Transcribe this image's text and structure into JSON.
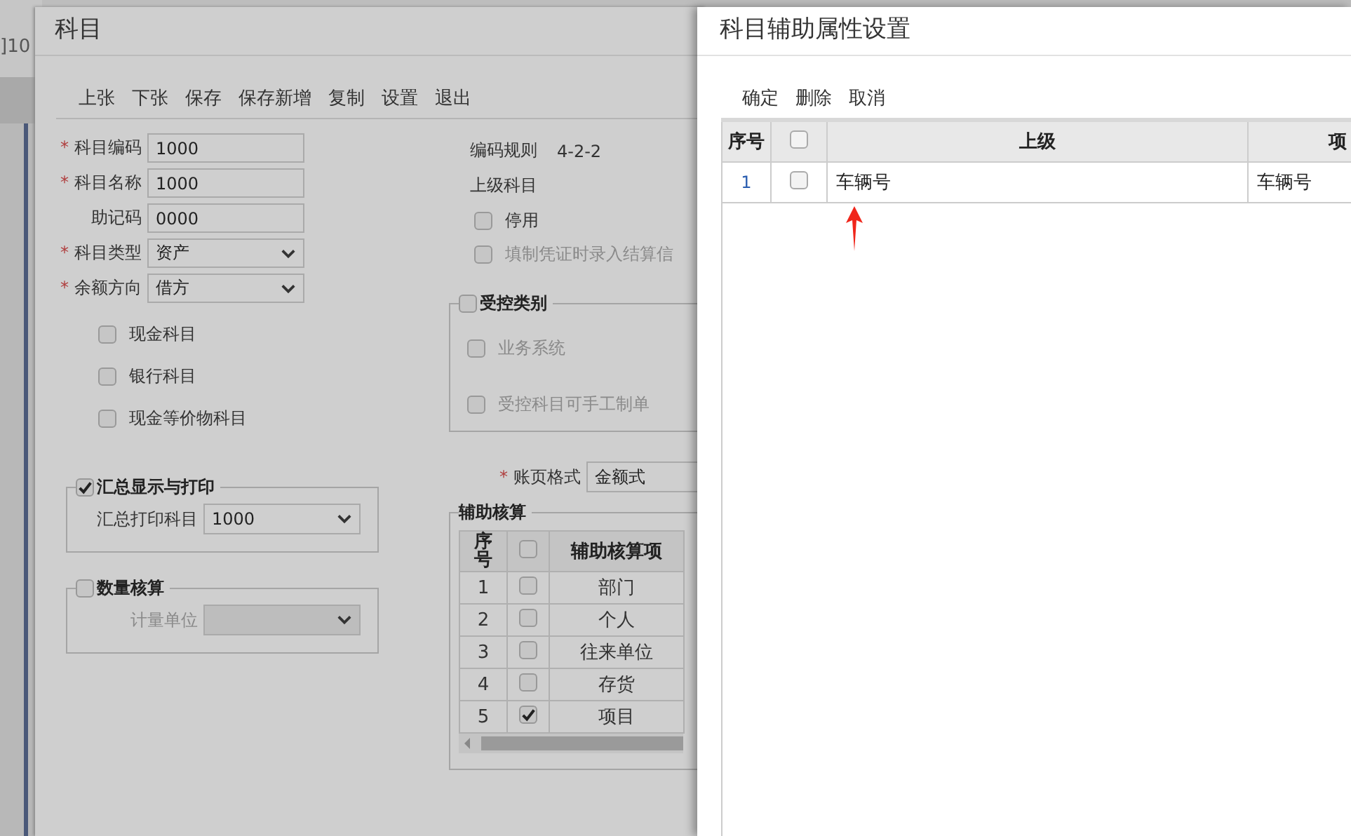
{
  "background_page": {
    "text": "]10"
  },
  "main_dialog": {
    "title": "科目",
    "toolbar": [
      "上张",
      "下张",
      "保存",
      "保存新增",
      "复制",
      "设置",
      "退出"
    ],
    "fields": [
      {
        "label": "科目编码",
        "required_mark": "*",
        "kind": "text",
        "value": "1000"
      },
      {
        "label": "科目名称",
        "required_mark": "*",
        "kind": "text",
        "value": "1000"
      },
      {
        "label": "助记码",
        "kind": "text",
        "value": "0000"
      },
      {
        "label": "科目类型",
        "required_mark": "*",
        "kind": "select",
        "value": "资产"
      },
      {
        "label": "余额方向",
        "required_mark": "*",
        "kind": "select",
        "value": "借方"
      }
    ],
    "account_checks": [
      {
        "label": "现金科目",
        "checked": false
      },
      {
        "label": "银行科目",
        "checked": false
      },
      {
        "label": "现金等价物科目",
        "checked": false
      }
    ],
    "summary_print": {
      "legend": "汇总显示与打印",
      "checked": true,
      "label": "汇总打印科目",
      "value": "1000",
      "disabled": false
    },
    "quantity": {
      "legend": "数量核算",
      "checked": false,
      "label": "计量单位",
      "disabled": true
    },
    "coding_rule": {
      "label": "编码规则",
      "value": "4-2-2"
    },
    "parent_account": {
      "label": "上级科目"
    },
    "options": [
      {
        "label": "停用",
        "checked": false,
        "disabled": false
      },
      {
        "label": "填制凭证时录入结算信",
        "checked": false,
        "disabled": true
      }
    ],
    "controlled": {
      "legend": "受控类别",
      "checked": false,
      "items": [
        {
          "label": "业务系统",
          "checked": false,
          "disabled": true
        },
        {
          "label": "受控科目可手工制单",
          "checked": false,
          "disabled": true
        }
      ]
    },
    "ledger_format": {
      "label": "账页格式",
      "required_mark": "*",
      "value": "金额式"
    },
    "aux": {
      "legend": "辅助核算",
      "columns": [
        "序号",
        "辅助核算项"
      ],
      "header_checked": false,
      "rows": [
        {
          "no": "1",
          "checked": false,
          "item": "部门"
        },
        {
          "no": "2",
          "checked": false,
          "item": "个人"
        },
        {
          "no": "3",
          "checked": false,
          "item": "往来单位"
        },
        {
          "no": "4",
          "checked": false,
          "item": "存货"
        },
        {
          "no": "5",
          "checked": true,
          "item": "项目"
        }
      ]
    }
  },
  "aux_dialog": {
    "title": "科目辅助属性设置",
    "toolbar": [
      "确定",
      "删除",
      "取消"
    ],
    "table": {
      "columns": [
        "序号",
        "上级",
        "项"
      ],
      "header_checked": false,
      "rows": [
        {
          "no": "1",
          "checked": false,
          "parent": "车辆号",
          "column_4": "车辆号"
        }
      ]
    }
  }
}
